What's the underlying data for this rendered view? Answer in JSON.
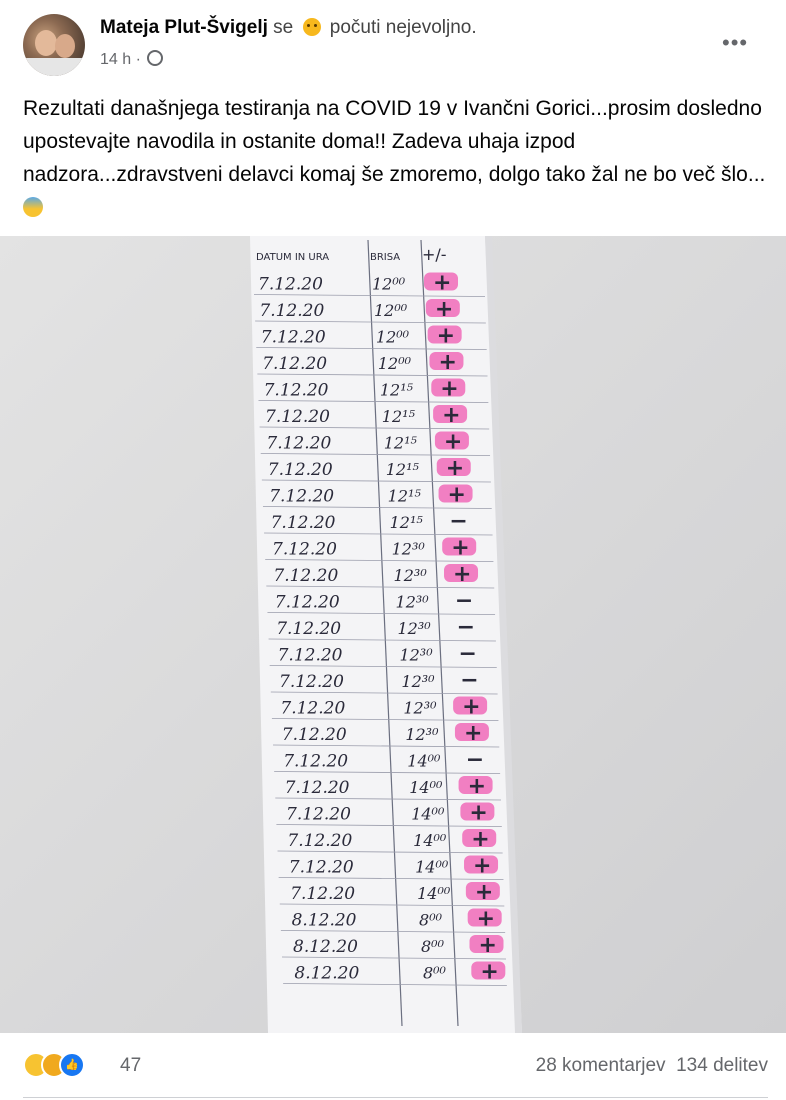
{
  "post": {
    "author": "Mateja Plut-Švigelj",
    "feeling_prefix": "se",
    "feeling": "počuti nejevoljno.",
    "time": "14 h ·",
    "text": "Rezultati današnjega testiranja na COVID 19 v Ivančni Gorici...prosim dosledno upostevajte navodila in ostanite doma!! Zadeva uhaja izpod nadzora...zdravstveni delavci komaj še zmoremo, dolgo tako žal ne bo več šlo..."
  },
  "photo": {
    "header": [
      "DATUM IN URA",
      "BRISA",
      "+/-"
    ],
    "rows": [
      [
        "7.12.20",
        "12⁰⁰",
        "+"
      ],
      [
        "7.12.20",
        "12⁰⁰",
        "+"
      ],
      [
        "7.12.20",
        "12⁰⁰",
        "+"
      ],
      [
        "7.12.20",
        "12⁰⁰",
        "+"
      ],
      [
        "7.12.20",
        "12¹⁵",
        "+"
      ],
      [
        "7.12.20",
        "12¹⁵",
        "+"
      ],
      [
        "7.12.20",
        "12¹⁵",
        "+"
      ],
      [
        "7.12.20",
        "12¹⁵",
        "+"
      ],
      [
        "7.12.20",
        "12¹⁵",
        "+"
      ],
      [
        "7.12.20",
        "12¹⁵",
        "−"
      ],
      [
        "7.12.20",
        "12³⁰",
        "+"
      ],
      [
        "7.12.20",
        "12³⁰",
        "+"
      ],
      [
        "7.12.20",
        "12³⁰",
        "−"
      ],
      [
        "7.12.20",
        "12³⁰",
        "−"
      ],
      [
        "7.12.20",
        "12³⁰",
        "−"
      ],
      [
        "7.12.20",
        "12³⁰",
        "−"
      ],
      [
        "7.12.20",
        "12³⁰",
        "+"
      ],
      [
        "7.12.20",
        "12³⁰",
        "+"
      ],
      [
        "7.12.20",
        "14⁰⁰",
        "−"
      ],
      [
        "7.12.20",
        "14⁰⁰",
        "+"
      ],
      [
        "7.12.20",
        "14⁰⁰",
        "+"
      ],
      [
        "7.12.20",
        "14⁰⁰",
        "+"
      ],
      [
        "7.12.20",
        "14⁰⁰",
        "+"
      ],
      [
        "7.12.20",
        "14⁰⁰",
        "+"
      ],
      [
        "8.12.20",
        "8⁰⁰",
        "+"
      ],
      [
        "8.12.20",
        "8⁰⁰",
        "+"
      ],
      [
        "8.12.20",
        "8⁰⁰",
        "+"
      ]
    ]
  },
  "footer": {
    "reaction_count": "47",
    "comments": "28 komentarjev",
    "shares": "134 delitev"
  },
  "colors": {
    "highlight": "#f06ab8",
    "ink": "#2a2a3a"
  }
}
